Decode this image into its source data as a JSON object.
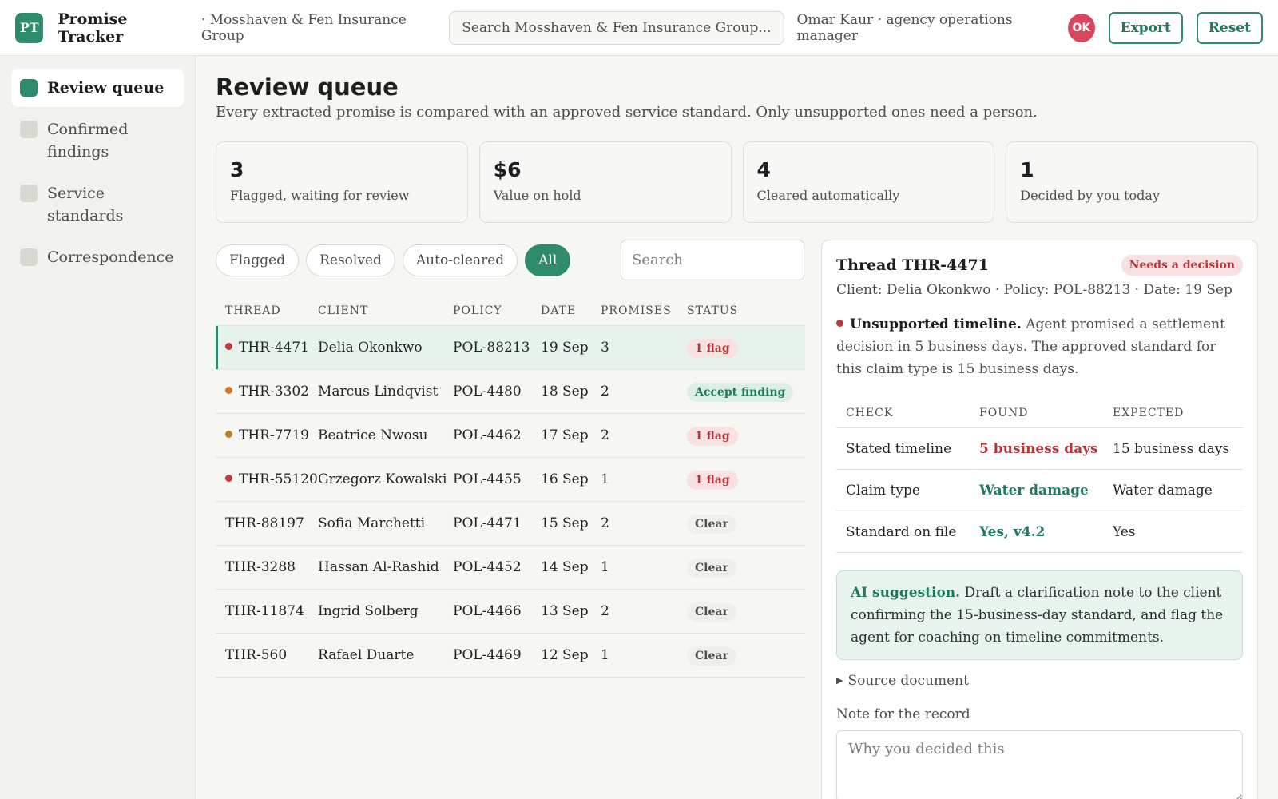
{
  "header": {
    "logo": "PT",
    "app_name": "Promise Tracker",
    "org_name": "· Mosshaven & Fen Insurance Group",
    "search_placeholder": "Search Mosshaven & Fen Insurance Group...",
    "user": "Omar Kaur · agency operations manager",
    "avatar_initials": "OK",
    "export_label": "Export",
    "reset_label": "Reset"
  },
  "sidebar": {
    "items": [
      {
        "label": "Review queue",
        "active": true
      },
      {
        "label": "Confirmed findings",
        "active": false
      },
      {
        "label": "Service standards",
        "active": false
      },
      {
        "label": "Correspondence",
        "active": false
      }
    ]
  },
  "page": {
    "title": "Review queue",
    "subtitle": "Every extracted promise is compared with an approved service standard. Only unsupported ones need a person."
  },
  "stats": [
    {
      "value": "3",
      "label": "Flagged, waiting for review"
    },
    {
      "value": "$6",
      "label": "Value on hold"
    },
    {
      "value": "4",
      "label": "Cleared automatically"
    },
    {
      "value": "1",
      "label": "Decided by you today"
    }
  ],
  "filters": {
    "chips": [
      "Flagged",
      "Resolved",
      "Auto-cleared",
      "All"
    ],
    "active": "All",
    "search_placeholder": "Search"
  },
  "table": {
    "columns": [
      "THREAD",
      "CLIENT",
      "POLICY",
      "DATE",
      "PROMISES",
      "STATUS"
    ],
    "rows": [
      {
        "thread": "THR-4471",
        "client": "Delia Okonkwo",
        "policy": "POL-88213",
        "date": "19 Sep",
        "promises": "3",
        "status": "1 flag",
        "status_kind": "flag",
        "dot": "red",
        "selected": true
      },
      {
        "thread": "THR-3302",
        "client": "Marcus Lindqvist",
        "policy": "POL-4480",
        "date": "18 Sep",
        "promises": "2",
        "status": "Accept finding",
        "status_kind": "accept",
        "dot": "orange",
        "selected": false
      },
      {
        "thread": "THR-7719",
        "client": "Beatrice Nwosu",
        "policy": "POL-4462",
        "date": "17 Sep",
        "promises": "2",
        "status": "1 flag",
        "status_kind": "flag",
        "dot": "orange",
        "selected": false
      },
      {
        "thread": "THR-55120",
        "client": "Grzegorz Kowalski",
        "policy": "POL-4455",
        "date": "16 Sep",
        "promises": "1",
        "status": "1 flag",
        "status_kind": "flag",
        "dot": "red",
        "selected": false
      },
      {
        "thread": "THR-88197",
        "client": "Sofia Marchetti",
        "policy": "POL-4471",
        "date": "15 Sep",
        "promises": "2",
        "status": "Clear",
        "status_kind": "clear",
        "dot": "",
        "selected": false
      },
      {
        "thread": "THR-3288",
        "client": "Hassan Al-Rashid",
        "policy": "POL-4452",
        "date": "14 Sep",
        "promises": "1",
        "status": "Clear",
        "status_kind": "clear",
        "dot": "",
        "selected": false
      },
      {
        "thread": "THR-11874",
        "client": "Ingrid Solberg",
        "policy": "POL-4466",
        "date": "13 Sep",
        "promises": "2",
        "status": "Clear",
        "status_kind": "clear",
        "dot": "",
        "selected": false
      },
      {
        "thread": "THR-560",
        "client": "Rafael Duarte",
        "policy": "POL-4469",
        "date": "12 Sep",
        "promises": "1",
        "status": "Clear",
        "status_kind": "clear",
        "dot": "",
        "selected": false
      }
    ]
  },
  "detail": {
    "title": "Thread THR-4471",
    "badge": "Needs a decision",
    "meta": "Client: Delia Okonkwo · Policy: POL-88213 · Date: 19 Sep",
    "finding_title": "Unsupported timeline.",
    "finding_text": " Agent promised a settlement decision in 5 business days. The approved standard for this claim type is 15 business days.",
    "check_columns": [
      "CHECK",
      "FOUND",
      "EXPECTED"
    ],
    "checks": [
      {
        "check": "Stated timeline",
        "found": "5 business days",
        "expected": "15 business days",
        "ok": false
      },
      {
        "check": "Claim type",
        "found": "Water damage",
        "expected": "Water damage",
        "ok": true
      },
      {
        "check": "Standard on file",
        "found": "Yes, v4.2",
        "expected": "Yes",
        "ok": true
      }
    ],
    "ai_label": "AI suggestion.",
    "ai_text": " Draft a clarification note to the client confirming the 15-business-day standard, and flag the agent for coaching on timeline commitments.",
    "source_label": "Source document",
    "note_label": "Note for the record",
    "note_placeholder": "Why you decided this"
  },
  "colors": {
    "accent": "#2e8b6b",
    "flag": "#b8353a",
    "avatar": "#d9465e"
  }
}
